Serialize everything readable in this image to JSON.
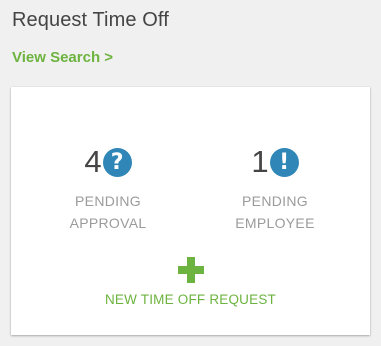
{
  "header": {
    "title": "Request Time Off",
    "view_search_link": "View Search >"
  },
  "stats": [
    {
      "count": "4",
      "icon": "question-icon",
      "icon_glyph": "?",
      "label_line1": "PENDING",
      "label_line2": "APPROVAL"
    },
    {
      "count": "1",
      "icon": "exclamation-icon",
      "icon_glyph": "!",
      "label_line1": "PENDING",
      "label_line2": "EMPLOYEE"
    }
  ],
  "new_request": {
    "icon": "plus-icon",
    "label": "NEW TIME OFF REQUEST"
  },
  "colors": {
    "accent_green": "#6db33f",
    "badge_blue": "#2f86b7",
    "title_text": "#444444",
    "muted_text": "#9b9b9b"
  }
}
